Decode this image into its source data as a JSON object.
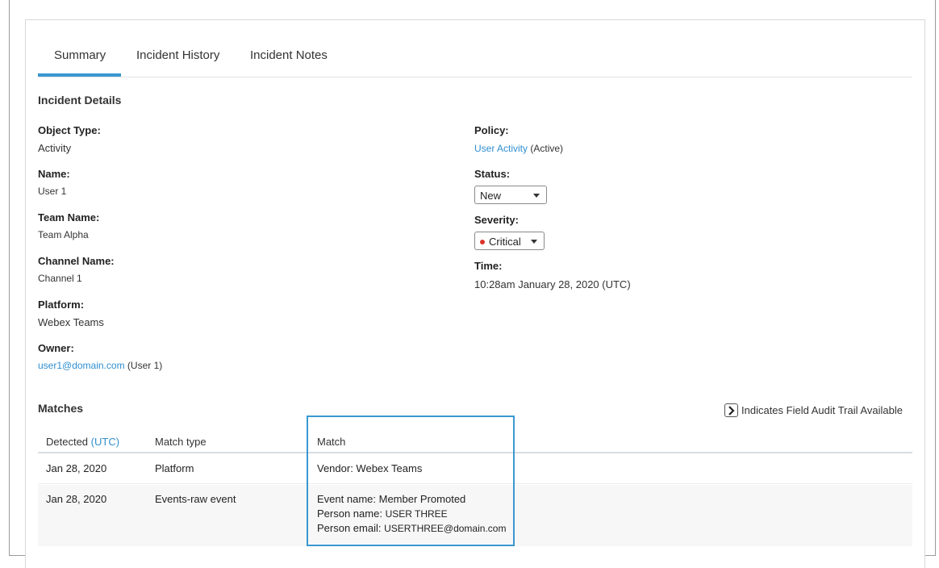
{
  "tabs": [
    {
      "label": "Summary"
    },
    {
      "label": "Incident History"
    },
    {
      "label": "Incident Notes"
    }
  ],
  "incident_details": {
    "title": "Incident Details",
    "object_type": {
      "label": "Object Type:",
      "value": "Activity"
    },
    "name": {
      "label": "Name:",
      "value": "User 1"
    },
    "team_name": {
      "label": "Team Name:",
      "value": "Team Alpha"
    },
    "channel_name": {
      "label": "Channel Name:",
      "value": "Channel 1"
    },
    "platform": {
      "label": "Platform:",
      "value": "Webex Teams"
    },
    "owner": {
      "label": "Owner:",
      "email": "user1@domain.com",
      "suffix": "(User 1)"
    },
    "policy": {
      "label": "Policy:",
      "link": "User Activity",
      "suffix": "(Active)"
    },
    "status": {
      "label": "Status:",
      "value": "New"
    },
    "severity": {
      "label": "Severity:",
      "value": "Critical"
    },
    "time": {
      "label": "Time:",
      "value": "10:28am January 28, 2020 (UTC)"
    }
  },
  "matches": {
    "title": "Matches",
    "audit_note": "Indicates Field Audit Trail Available",
    "columns": {
      "detected": "Detected",
      "detected_tz": "(UTC)",
      "match_type": "Match type",
      "match": "Match"
    },
    "rows": [
      {
        "detected": "Jan 28, 2020",
        "match_type": "Platform",
        "match": "Vendor: Webex Teams"
      },
      {
        "detected": "Jan 28, 2020",
        "match_type": "Events-raw event",
        "event_name_label": "Event name:",
        "event_name": "Member Promoted",
        "person_name_label": "Person name:",
        "person_name": "USER THREE",
        "person_email_label": "Person email:",
        "person_email": "USERTHREE@domain.com"
      }
    ]
  },
  "colors": {
    "accent": "#3a98d2",
    "link": "#2f8fd0",
    "critical": "#d9342b"
  }
}
